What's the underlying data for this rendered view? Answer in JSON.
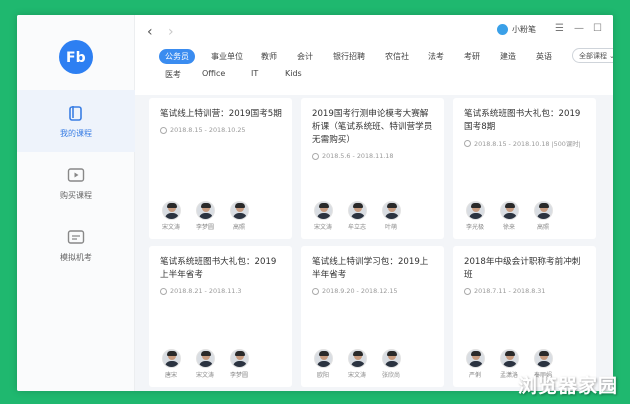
{
  "app": {
    "brand_name": "小粉笔",
    "logo_text": "Fb"
  },
  "nav": {
    "back": "‹",
    "forward": "›"
  },
  "window_controls": {
    "menu": "☰",
    "minimize": "—",
    "maximize": "☐",
    "close": "✕"
  },
  "sidebar": {
    "items": [
      {
        "label": "我的课程",
        "icon": "book-icon",
        "active": true
      },
      {
        "label": "购买课程",
        "icon": "play-icon",
        "active": false
      },
      {
        "label": "模拟机考",
        "icon": "exam-icon",
        "active": false
      }
    ]
  },
  "categories": {
    "row1": [
      "公务员",
      "事业单位",
      "教师",
      "会计",
      "银行招聘",
      "农信社",
      "法考",
      "考研",
      "建造",
      "英语"
    ],
    "row2": [
      "医考",
      "Office",
      "IT",
      "Kids"
    ],
    "active": "公务员",
    "all_label": "全部课程",
    "all_chevron": "⌄"
  },
  "cards": [
    {
      "title": "笔试线上特训营：2019国考5期",
      "date": "2018.8.15 - 2018.10.25",
      "teachers": [
        "宋文涛",
        "李梦圆",
        "高照"
      ]
    },
    {
      "title": "2019国考行测申论模考大赛解析课（笔试系统班、特训营学员无需购买）",
      "date": "2018.5.6 - 2018.11.18",
      "teachers": [
        "宋文涛",
        "牟立志",
        "叶萌"
      ]
    },
    {
      "title": "笔试系统班图书大礼包：2019国考8期",
      "date": "2018.8.15 - 2018.10.18  |500课时|",
      "teachers": [
        "李光极",
        "徐来",
        "高照"
      ]
    },
    {
      "title": "笔试系统班图书大礼包：2019上半年省考",
      "date": "2018.8.21 - 2018.11.3",
      "teachers": [
        "唐宋",
        "宋文涛",
        "李梦圆"
      ]
    },
    {
      "title": "笔试线上特训学习包：2019上半年省考",
      "date": "2018.9.20 - 2018.12.15",
      "teachers": [
        "欧阳",
        "宋文涛",
        "张欣尚"
      ]
    },
    {
      "title": "2018年中级会计职称考前冲刺班",
      "date": "2018.7.11 - 2018.8.31",
      "teachers": [
        "严俐",
        "孟潇洛",
        "秦丽娟"
      ]
    }
  ],
  "watermark": "浏览器家园",
  "colors": {
    "accent": "#3a8cf0",
    "logo": "#2d7ff2",
    "background": "#1fb86f"
  }
}
